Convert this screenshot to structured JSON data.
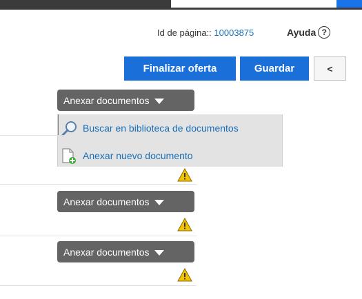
{
  "header": {
    "page_id_label": "Id de página::",
    "page_id_value": "10003875",
    "help_label": "Ayuda",
    "help_icon": "?"
  },
  "toolbar": {
    "finalize_label": "Finalizar oferta",
    "save_label": "Guardar",
    "back_label": "<"
  },
  "attachments": {
    "button_label": "Anexar documentos",
    "menu": [
      {
        "label": "Buscar en biblioteca de documentos",
        "icon": "magnifier-icon"
      },
      {
        "label": "Anexar nuevo documento",
        "icon": "new-document-icon"
      }
    ]
  },
  "colors": {
    "accent": "#1a6fd9",
    "link": "#1a6fb7",
    "dark_button": "#646464",
    "menu_bg": "#e3e3e3",
    "warning": "#f2c200"
  }
}
